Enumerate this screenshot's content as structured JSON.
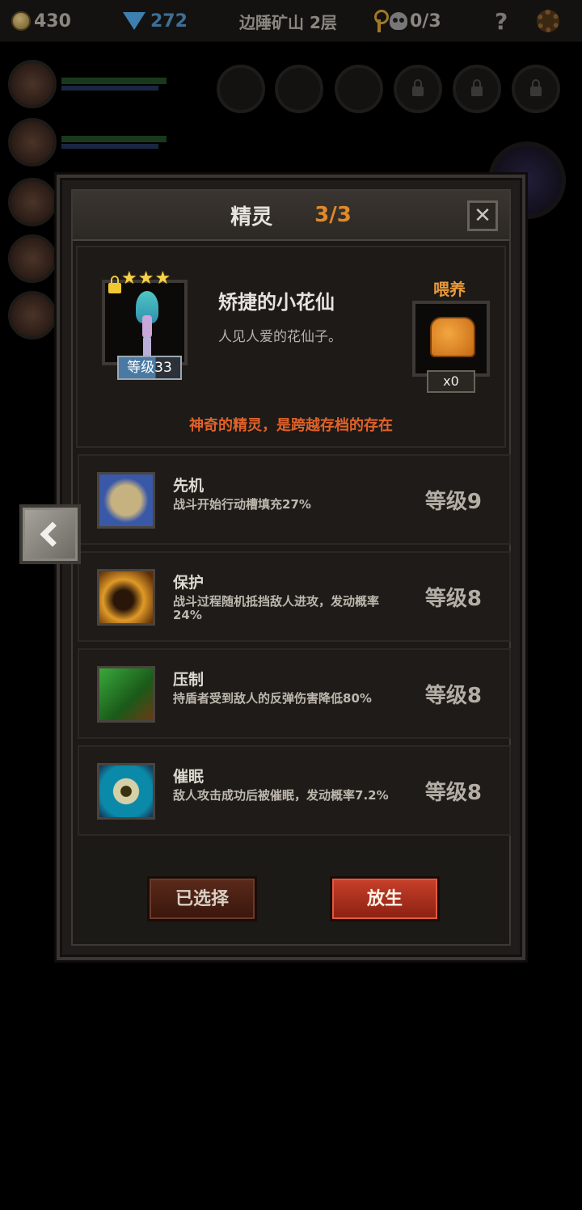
{
  "topbar": {
    "gold": "430",
    "gems": "272",
    "location": "边陲矿山 2层",
    "skull_count": "0/3",
    "help": "?"
  },
  "modal": {
    "title": "精灵",
    "count": "3/3",
    "close": "✕"
  },
  "pet": {
    "name": "矫捷的小花仙",
    "description": "人见人爱的花仙子。",
    "stars": "★★★",
    "level": "等级33",
    "feed_label": "喂养",
    "feed_count": "x0",
    "note": "神奇的精灵，是跨越存档的存在"
  },
  "skills": [
    {
      "name": "先机",
      "desc": "战斗开始行动槽填充27%",
      "level": "等级9",
      "icon": "leopard-icon"
    },
    {
      "name": "保护",
      "desc": "战斗过程随机抵挡敌人进攻，发动概率24%",
      "level": "等级8",
      "icon": "fairy-shield-icon"
    },
    {
      "name": "压制",
      "desc": "持盾者受到敌人的反弹伤害降低80%",
      "level": "等级8",
      "icon": "claw-icon"
    },
    {
      "name": "催眠",
      "desc": "敌人攻击成功后被催眠，发动概率7.2%",
      "level": "等级8",
      "icon": "eye-icon"
    }
  ],
  "buttons": {
    "selected": "已选择",
    "release": "放生"
  },
  "colors": {
    "accent_orange": "#e08a2a",
    "note_red": "#e0622a",
    "release_red": "#c8402a"
  }
}
